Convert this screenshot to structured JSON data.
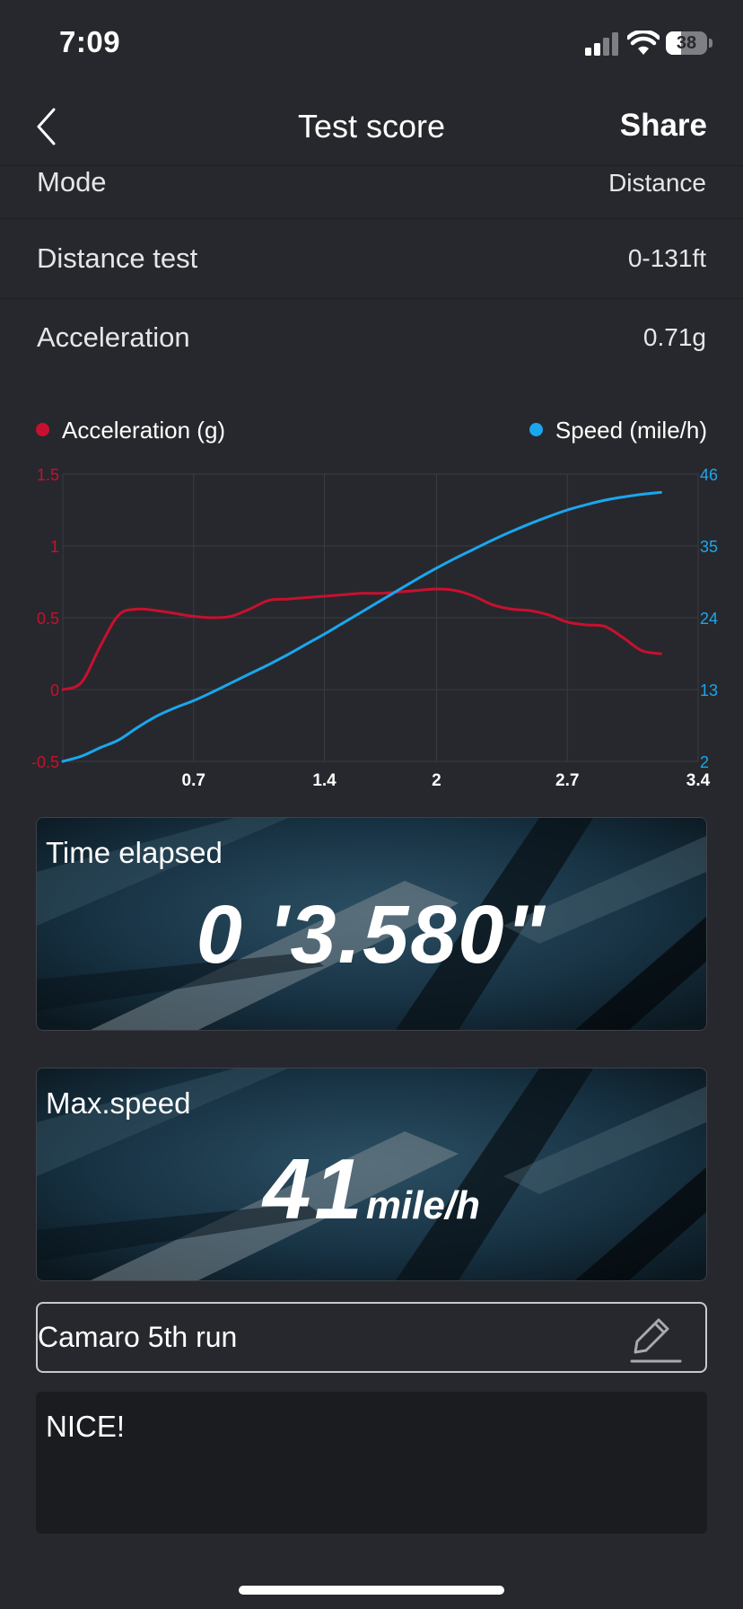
{
  "status_bar": {
    "time": "7:09",
    "battery": "38",
    "battery_level": 0.38
  },
  "nav": {
    "back_icon": "chevron-left-icon",
    "title": "Test score",
    "share_label": "Share"
  },
  "info_rows": [
    {
      "label": "Mode",
      "value": "Distance"
    },
    {
      "label": "Distance test",
      "value": "0-131ft"
    },
    {
      "label": "Acceleration",
      "value": "0.71g"
    }
  ],
  "chart_data": {
    "type": "line",
    "grid": true,
    "legend_placement": "top",
    "x_ticks": [
      "0.7",
      "1.4",
      "2",
      "2.7",
      "3.4"
    ],
    "xlim": [
      0,
      3.4
    ],
    "left_axis": {
      "ticks": [
        "1.5",
        "1",
        "0.5",
        "0",
        "-0.5"
      ],
      "ylim": [
        -0.5,
        1.5
      ],
      "color": "#c8102e"
    },
    "right_axis": {
      "ticks": [
        "46",
        "35",
        "24",
        "13",
        "2"
      ],
      "ylim": [
        2,
        46
      ],
      "color": "#1aa7ee"
    },
    "series": [
      {
        "name": "Acceleration (g)",
        "axis": "left",
        "color": "#c8102e",
        "x": [
          0,
          0.1,
          0.2,
          0.3,
          0.4,
          0.5,
          0.6,
          0.7,
          0.8,
          0.9,
          1.0,
          1.1,
          1.2,
          1.3,
          1.4,
          1.5,
          1.6,
          1.7,
          1.8,
          1.9,
          2.0,
          2.1,
          2.2,
          2.3,
          2.4,
          2.5,
          2.6,
          2.7,
          2.8,
          2.9,
          3.0,
          3.1,
          3.2
        ],
        "y": [
          0.0,
          0.05,
          0.3,
          0.52,
          0.56,
          0.55,
          0.53,
          0.51,
          0.5,
          0.51,
          0.56,
          0.62,
          0.63,
          0.64,
          0.65,
          0.66,
          0.67,
          0.67,
          0.68,
          0.69,
          0.7,
          0.69,
          0.65,
          0.59,
          0.56,
          0.55,
          0.52,
          0.47,
          0.45,
          0.44,
          0.36,
          0.27,
          0.25
        ]
      },
      {
        "name": "Speed (mile/h)",
        "axis": "right",
        "color": "#1aa7ee",
        "x": [
          0,
          0.1,
          0.2,
          0.3,
          0.4,
          0.5,
          0.6,
          0.7,
          0.8,
          0.9,
          1.0,
          1.1,
          1.2,
          1.3,
          1.4,
          1.5,
          1.6,
          1.7,
          1.8,
          1.9,
          2.0,
          2.1,
          2.2,
          2.3,
          2.4,
          2.5,
          2.6,
          2.7,
          2.8,
          2.9,
          3.0,
          3.1,
          3.2
        ],
        "y": [
          2,
          2.8,
          4.1,
          5.3,
          7.2,
          8.9,
          10.2,
          11.3,
          12.6,
          14.0,
          15.4,
          16.8,
          18.3,
          19.9,
          21.5,
          23.2,
          24.9,
          26.6,
          28.3,
          30.0,
          31.6,
          33.1,
          34.5,
          35.9,
          37.2,
          38.4,
          39.5,
          40.5,
          41.3,
          42.0,
          42.5,
          42.9,
          43.2
        ]
      }
    ]
  },
  "time_elapsed": {
    "label": "Time elapsed",
    "value": "0 '3.580\""
  },
  "max_speed": {
    "label": "Max.speed",
    "value": "41",
    "unit": "mile/h"
  },
  "run_name": {
    "value": "Camaro 5th run",
    "edit_icon": "pencil-edit-icon"
  },
  "notes": {
    "value": "NICE!"
  }
}
